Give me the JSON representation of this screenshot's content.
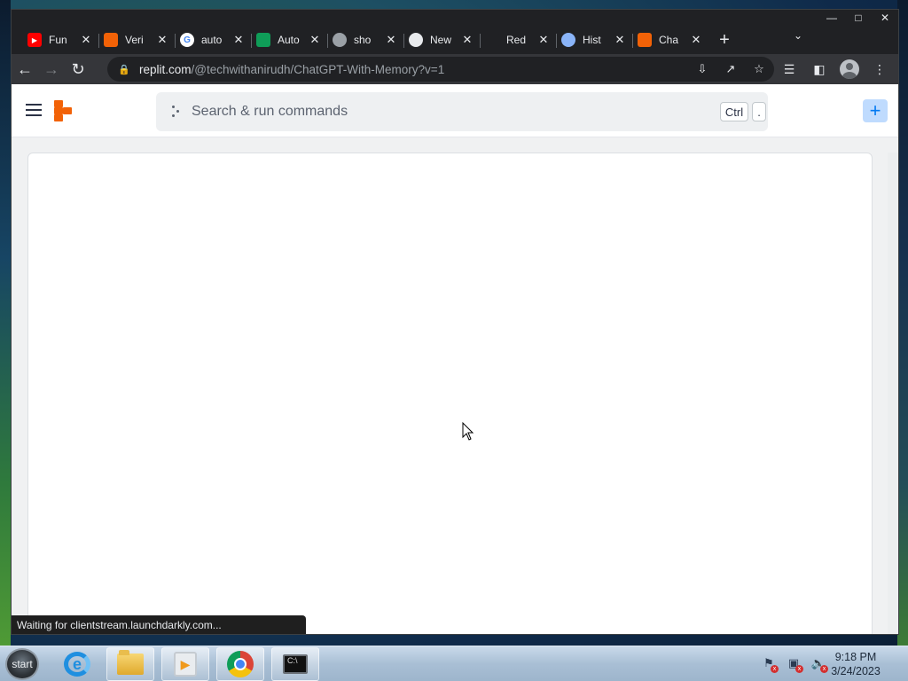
{
  "browser": {
    "tabs": [
      {
        "title": "Fun",
        "icon": "youtube-icon",
        "color": "#ff0000"
      },
      {
        "title": "Veri",
        "icon": "replit-icon",
        "color": "#f26207"
      },
      {
        "title": "auto",
        "icon": "google-icon",
        "color": "#4285f4"
      },
      {
        "title": "Auto",
        "icon": "sheets-icon",
        "color": "#0f9d58"
      },
      {
        "title": "sho",
        "icon": "globe-icon",
        "color": "#9aa0a6"
      },
      {
        "title": "New",
        "icon": "chrome-icon",
        "color": "#e8eaed"
      },
      {
        "title": "Red",
        "icon": "blank-icon",
        "color": "#202124"
      },
      {
        "title": "Hist",
        "icon": "history-icon",
        "color": "#8ab4f8"
      },
      {
        "title": "Cha",
        "icon": "replit-icon",
        "color": "#f26207"
      }
    ],
    "new_tab": "+",
    "url_host": "replit.com",
    "url_path": "/@techwithanirudh/ChatGPT-With-Memory?v=1"
  },
  "replit": {
    "search_placeholder": "Search & run commands",
    "kbd_ctrl": "Ctrl",
    "kbd_dot": ".",
    "plus_label": "+"
  },
  "status_text": "Waiting for clientstream.launchdarkly.com...",
  "taskbar": {
    "start_label": "start",
    "time": "9:18 PM",
    "date": "3/24/2023"
  }
}
